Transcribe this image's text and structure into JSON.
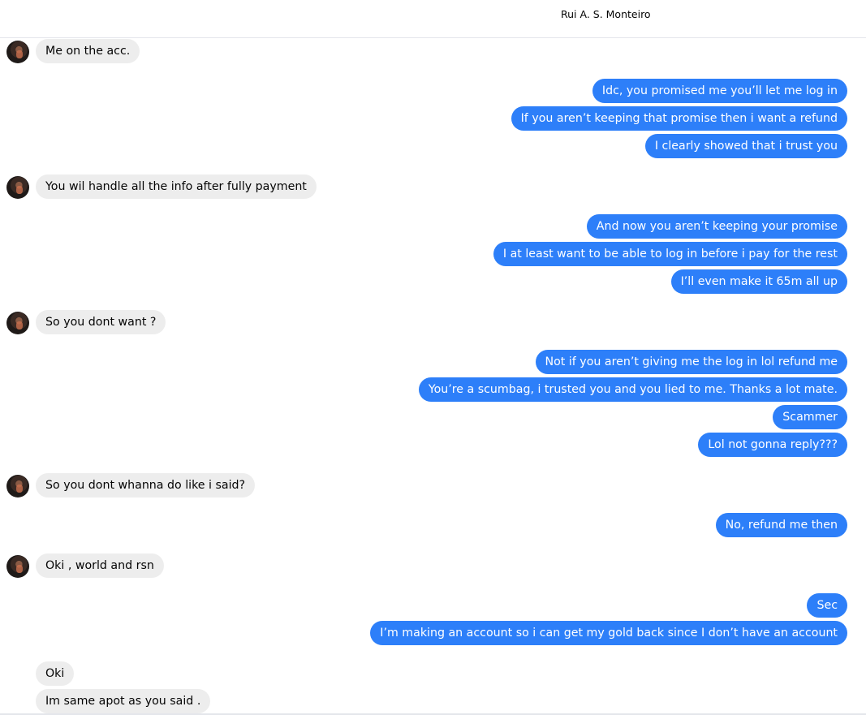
{
  "header": {
    "title": "Rui A. S. Monteiro"
  },
  "messages": {
    "m01": "Me on the acc.",
    "m02": "Idc, you promised me you’ll let me log in",
    "m03": "If you aren’t keeping that promise then i want a refund",
    "m04": "I clearly showed that i trust you",
    "m05": "You wil handle all the info after fully payment",
    "m06": "And now you aren’t keeping your promise",
    "m07": "I at least want to be able to log in before i pay for the rest",
    "m08": "I’ll even make it 65m all up",
    "m09": "So you dont want ?",
    "m10": "Not if you aren’t giving me the log in lol refund me",
    "m11": "You’re a scumbag, i trusted you and you lied to me. Thanks a lot mate.",
    "m12": "Scammer",
    "m13": "Lol not gonna reply???",
    "m14": "So you dont whanna do like i said?",
    "m15": "No, refund me then",
    "m16": "Oki , world and rsn",
    "m17": "Sec",
    "m18": "I’m making an account so i can get my gold back since I don’t have an account",
    "m19": "Oki",
    "m20": "Im same apot as you said ."
  },
  "colors": {
    "outgoing_bubble": "#2d7ff9",
    "incoming_bubble": "#ededed"
  }
}
